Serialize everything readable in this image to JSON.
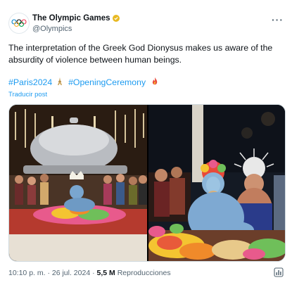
{
  "account": {
    "display_name": "The Olympic Games",
    "handle": "@Olympics",
    "avatar_icon": "olympic-rings-icon",
    "verified_icon": "verified-badge-icon",
    "verified_color": "#e8b923"
  },
  "tweet": {
    "text": "The interpretation of the Greek God Dionysus makes us aware of the absurdity of violence between human beings.",
    "hashtags": [
      "#Paris2024",
      "#OpeningCeremony"
    ],
    "translate_label": "Traducir post"
  },
  "meta": {
    "time": "10:10 p. m.",
    "separator": "·",
    "date": "26 jul. 2024",
    "views_count": "5,5 M",
    "views_label": "Reproducciones"
  },
  "colors": {
    "link": "#1d9bf0",
    "muted": "#536471",
    "text": "#0f1419"
  }
}
